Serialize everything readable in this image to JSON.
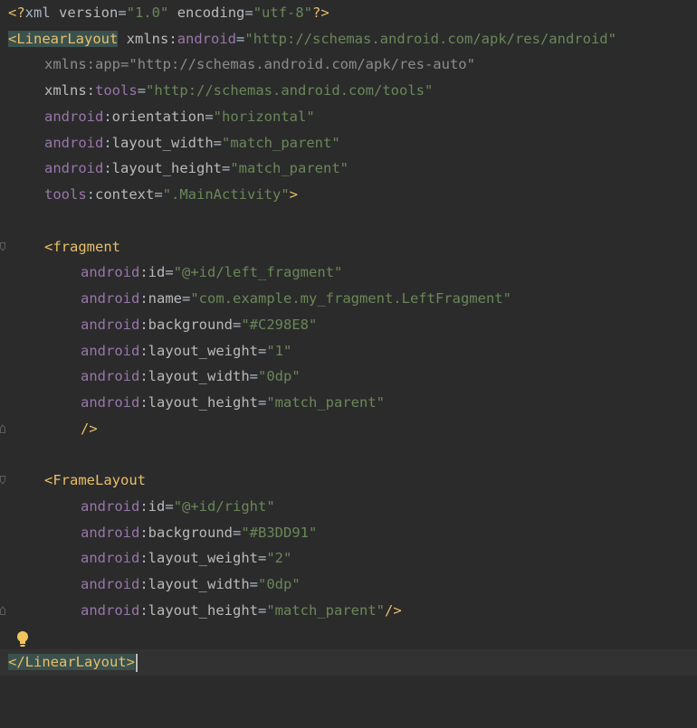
{
  "editor": {
    "lines": [
      {
        "prolog_open": "<?",
        "prolog_name": "xml",
        "a1": "version",
        "v1": "\"1.0\"",
        "a2": "encoding",
        "v2": "\"utf-8\"",
        "prolog_close": "?>"
      },
      {
        "open": "<",
        "tag": "LinearLayout",
        "ns": "xmlns",
        "colon": ":",
        "attr": "android",
        "eq": "=",
        "val": "\"http://schemas.android.com/apk/res/android\""
      },
      {
        "ns": "xmlns",
        "colon": ":",
        "attr": "app",
        "eq": "=",
        "val": "\"http://schemas.android.com/apk/res-auto\""
      },
      {
        "ns": "xmlns",
        "colon": ":",
        "attr": "tools",
        "eq": "=",
        "val": "\"http://schemas.android.com/tools\""
      },
      {
        "ns": "android",
        "colon": ":",
        "attr": "orientation",
        "eq": "=",
        "val": "\"horizontal\""
      },
      {
        "ns": "android",
        "colon": ":",
        "attr": "layout_width",
        "eq": "=",
        "val": "\"match_parent\""
      },
      {
        "ns": "android",
        "colon": ":",
        "attr": "layout_height",
        "eq": "=",
        "val": "\"match_parent\""
      },
      {
        "ns": "tools",
        "colon": ":",
        "attr": "context",
        "eq": "=",
        "val": "\".MainActivity\"",
        "close": ">"
      },
      {},
      {
        "open": "<",
        "tag": "fragment"
      },
      {
        "ns": "android",
        "colon": ":",
        "attr": "id",
        "eq": "=",
        "val": "\"@+id/left_fragment\""
      },
      {
        "ns": "android",
        "colon": ":",
        "attr": "name",
        "eq": "=",
        "val": "\"com.example.my_fragment.LeftFragment\""
      },
      {
        "ns": "android",
        "colon": ":",
        "attr": "background",
        "eq": "=",
        "val": "\"#C298E8\""
      },
      {
        "ns": "android",
        "colon": ":",
        "attr": "layout_weight",
        "eq": "=",
        "val": "\"1\""
      },
      {
        "ns": "android",
        "colon": ":",
        "attr": "layout_width",
        "eq": "=",
        "val": "\"0dp\""
      },
      {
        "ns": "android",
        "colon": ":",
        "attr": "layout_height",
        "eq": "=",
        "val": "\"match_parent\""
      },
      {
        "close": "/>"
      },
      {},
      {
        "open": "<",
        "tag": "FrameLayout"
      },
      {
        "ns": "android",
        "colon": ":",
        "attr": "id",
        "eq": "=",
        "val": "\"@+id/right\""
      },
      {
        "ns": "android",
        "colon": ":",
        "attr": "background",
        "eq": "=",
        "val": "\"#B3DD91\""
      },
      {
        "ns": "android",
        "colon": ":",
        "attr": "layout_weight",
        "eq": "=",
        "val": "\"2\""
      },
      {
        "ns": "android",
        "colon": ":",
        "attr": "layout_width",
        "eq": "=",
        "val": "\"0dp\""
      },
      {
        "ns": "android",
        "colon": ":",
        "attr": "layout_height",
        "eq": "=",
        "val": "\"match_parent\"",
        "close": "/>"
      },
      {},
      {
        "open": "</",
        "tag": "LinearLayout",
        "close": ">"
      }
    ]
  },
  "colors": {
    "background": "#2b2b2b",
    "tag": "#e8bf6a",
    "namespace": "#9876aa",
    "value": "#6a8759",
    "attribute": "#bababa",
    "current_line": "#323232",
    "tag_highlight": "#3b514d"
  },
  "icons": {
    "intention_bulb": "lightbulb-icon",
    "fold_marker": "fold-marker-icon"
  }
}
